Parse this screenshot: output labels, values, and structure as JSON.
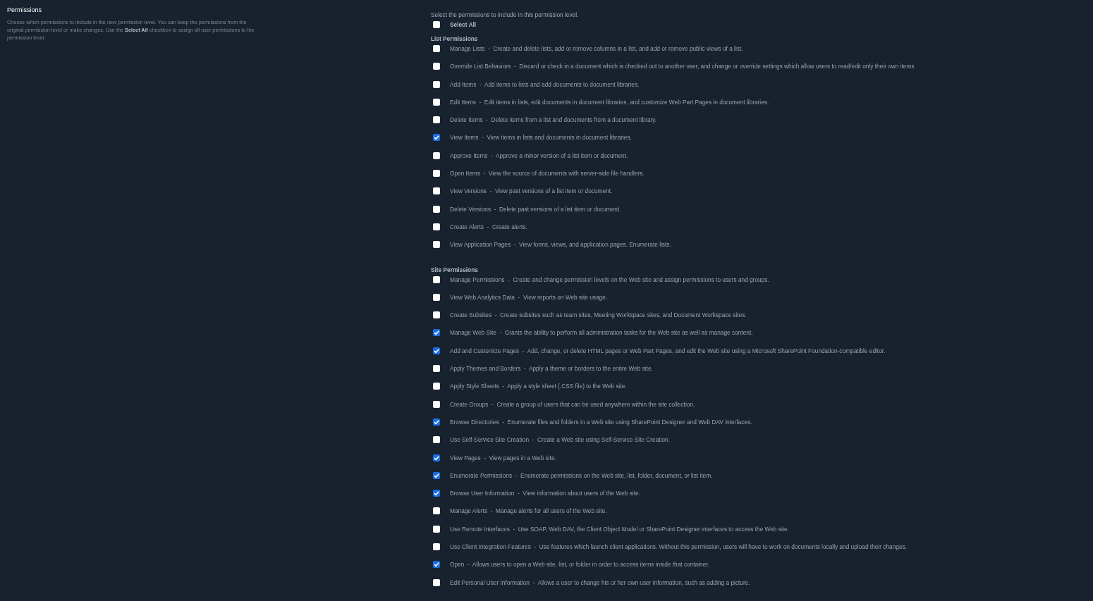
{
  "sidebar": {
    "title": "Permissions",
    "description": "Choose which permissions to include in the new permission level.  You can keep the permissions from the original permission level or make changes.  Use the **Select All** checkbox to assign all user permissions to the permission level."
  },
  "intro": "Select the permissions to include in this permission level.",
  "select_all": {
    "label": "Select All",
    "checked": false
  },
  "groups": [
    {
      "title": "List Permissions",
      "items": [
        {
          "label": "Manage Lists  -  Create and delete lists, add or remove columns in a list, and add or remove public views of a list.",
          "checked": false
        },
        {
          "label": "Override List Behaviors  -  Discard or check in a document which is checked out to another user, and change or override settings which allow users to read/edit only their own items",
          "checked": false
        },
        {
          "label": "Add Items  -  Add items to lists and add documents to document libraries.",
          "checked": false
        },
        {
          "label": "Edit Items  -  Edit items in lists, edit documents in document libraries, and customize Web Part Pages in document libraries.",
          "checked": false
        },
        {
          "label": "Delete Items  -  Delete items from a list and documents from a document library.",
          "checked": false
        },
        {
          "label": "View Items  -  View items in lists and documents in document libraries.",
          "checked": true
        },
        {
          "label": "Approve Items  -  Approve a minor version of a list item or document.",
          "checked": false
        },
        {
          "label": "Open Items  -  View the source of documents with server-side file handlers.",
          "checked": false
        },
        {
          "label": "View Versions  -  View past versions of a list item or document.",
          "checked": false
        },
        {
          "label": "Delete Versions  -  Delete past versions of a list item or document.",
          "checked": false
        },
        {
          "label": "Create Alerts  -  Create alerts.",
          "checked": false
        },
        {
          "label": "View Application Pages  -  View forms, views, and application pages. Enumerate lists.",
          "checked": false
        }
      ]
    },
    {
      "title": "Site Permissions",
      "items": [
        {
          "label": "Manage Permissions  -  Create and change permission levels on the Web site and assign permissions to users and groups.",
          "checked": false
        },
        {
          "label": "View Web Analytics Data  -  View reports on Web site usage.",
          "checked": false
        },
        {
          "label": "Create Subsites  -  Create subsites such as team sites, Meeting Workspace sites, and Document Workspace sites.",
          "checked": false
        },
        {
          "label": "Manage Web Site  -  Grants the ability to perform all administration tasks for the Web site as well as manage content.",
          "checked": true
        },
        {
          "label": "Add and Customize Pages  -  Add, change, or delete HTML pages or Web Part Pages, and edit the Web site using a Microsoft SharePoint Foundation-compatible editor.",
          "checked": true
        },
        {
          "label": "Apply Themes and Borders  -  Apply a theme or borders to the entire Web site.",
          "checked": false
        },
        {
          "label": "Apply Style Sheets  -  Apply a style sheet (.CSS file) to the Web site.",
          "checked": false
        },
        {
          "label": "Create Groups  -  Create a group of users that can be used anywhere within the site collection.",
          "checked": false
        },
        {
          "label": "Browse Directories  -  Enumerate files and folders in a Web site using SharePoint Designer and Web DAV interfaces.",
          "checked": true
        },
        {
          "label": "Use Self-Service Site Creation  -  Create a Web site using Self-Service Site Creation.",
          "checked": false
        },
        {
          "label": "View Pages  -  View pages in a Web site.",
          "checked": true
        },
        {
          "label": "Enumerate Permissions  -  Enumerate permissions on the Web site, list, folder, document, or list item.",
          "checked": true
        },
        {
          "label": "Browse User Information  -  View information about users of the Web site.",
          "checked": true
        },
        {
          "label": "Manage Alerts  -  Manage alerts for all users of the Web site.",
          "checked": false
        },
        {
          "label": "Use Remote Interfaces  -  Use SOAP, Web DAV, the Client Object Model or SharePoint Designer interfaces to access the Web site.",
          "checked": false
        },
        {
          "label": "Use Client Integration Features  -  Use features which launch client applications. Without this permission, users will have to work on documents locally and upload their changes.",
          "checked": false
        },
        {
          "label": "Open  -  Allows users to open a Web site, list, or folder in order to access items inside that container.",
          "checked": true
        },
        {
          "label": "Edit Personal User Information  -  Allows a user to change his or her own user information, such as adding a picture.",
          "checked": false
        }
      ]
    }
  ]
}
